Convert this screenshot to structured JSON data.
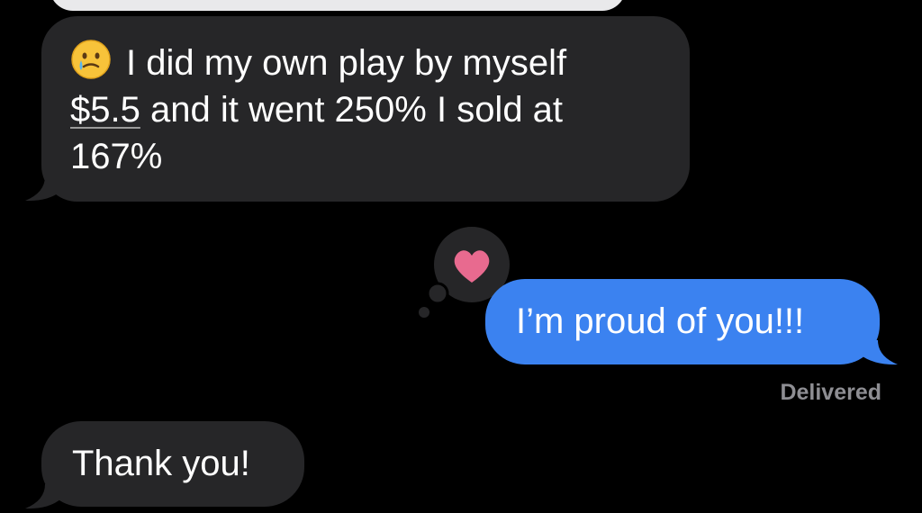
{
  "conversation": {
    "messages": [
      {
        "direction": "incoming",
        "emoji": "face-holding-back-tears",
        "lines": [
          "I did my own play by myself",
          "$5.5",
          " and it went 250% I sold at",
          "167%"
        ]
      },
      {
        "direction": "outgoing",
        "text": "I’m proud of you!!!",
        "tapback": "heart-icon",
        "status": "Delivered"
      },
      {
        "direction": "incoming",
        "text": "Thank you!"
      }
    ]
  },
  "colors": {
    "background": "#000000",
    "incoming_bubble": "#262628",
    "outgoing_bubble": "#3b82f0",
    "status_text": "#8e8e93",
    "heart": "#e86a8f"
  }
}
